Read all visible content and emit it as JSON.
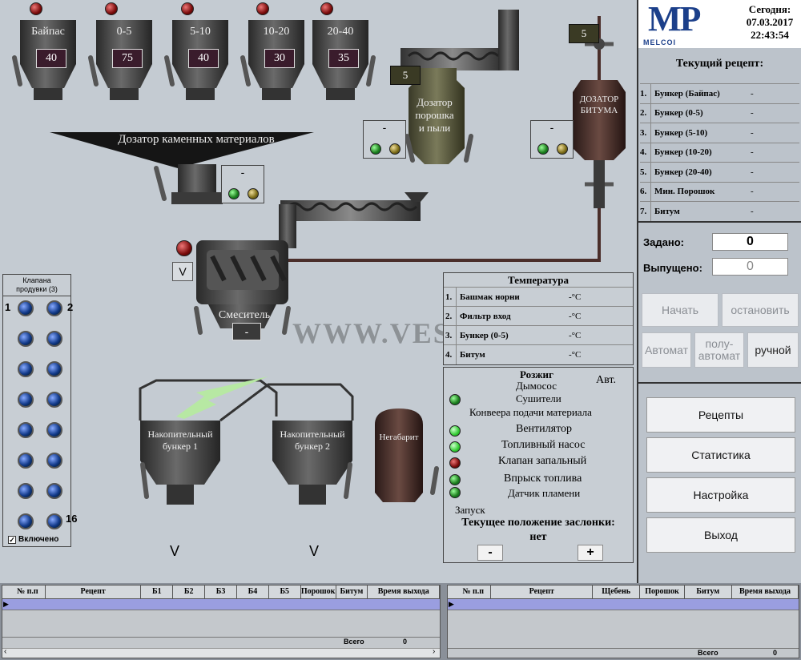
{
  "bunkers": [
    {
      "name": "Байпас",
      "value": "40"
    },
    {
      "name": "0-5",
      "value": "75"
    },
    {
      "name": "5-10",
      "value": "40"
    },
    {
      "name": "10-20",
      "value": "30"
    },
    {
      "name": "20-40",
      "value": "35"
    }
  ],
  "stone_dispenser": {
    "label": "Дозатор каменных материалов",
    "state": "-"
  },
  "powder_dispenser": {
    "label_l1": "Дозатор",
    "label_l2": "порошка",
    "label_l3": "и пыли",
    "value": "5",
    "state": "-"
  },
  "bitumen_dispenser": {
    "label_l1": "ДОЗАТОР",
    "label_l2": "БИТУМА",
    "value": "5",
    "state": "-"
  },
  "mixer": {
    "label": "Смеситель",
    "state": "-",
    "v_button": "V"
  },
  "valves_panel": {
    "title_l1": "Клапана",
    "title_l2": "продувки (3)",
    "first_num": "1",
    "second_num": "2",
    "last_num": "16",
    "enabled_label": "Включено"
  },
  "storage": {
    "bunker1_l1": "Накопительный",
    "bunker1_l2": "бункер 1",
    "bunker2_l1": "Накопительный",
    "bunker2_l2": "бункер 2",
    "oversize": "Негабарит",
    "v1": "V",
    "v2": "V"
  },
  "watermark": "WWW.VESY.KZ",
  "temperature": {
    "title": "Температура",
    "rows": [
      {
        "n": "1.",
        "name": "Башмак норни",
        "val": "-°C"
      },
      {
        "n": "2.",
        "name": "Фильтр вход",
        "val": "-°C"
      },
      {
        "n": "3.",
        "name": "Бункер (0-5)",
        "val": "-°C"
      },
      {
        "n": "4.",
        "name": "Битум",
        "val": "-°C"
      }
    ]
  },
  "ignition": {
    "title": "Розжиг",
    "mode": "Авт.",
    "smoke": "Дымосос",
    "dryers": "Сушители",
    "conveyor": "Конвеера подачи материала",
    "fan": "Вентилятор",
    "fuel_pump": "Топливный насос",
    "ign_valve": "Клапан запальный",
    "fuel_inject": "Впрыск топлива",
    "flame_sensor": "Датчик пламени",
    "launch": "Запуск",
    "damper_label": "Текущее положение заслонки:",
    "damper_value": "нет",
    "minus": "-",
    "plus": "+"
  },
  "header": {
    "logo_main": "MP",
    "logo_sub": "MELCOI",
    "today_label": "Сегодня:",
    "date": "07.03.2017",
    "time": "22:43:54"
  },
  "recipe": {
    "title": "Текущий рецепт:",
    "items": [
      {
        "n": "1.",
        "name": "Бункер (Байпас)",
        "val": "-"
      },
      {
        "n": "2.",
        "name": "Бункер (0-5)",
        "val": "-"
      },
      {
        "n": "3.",
        "name": "Бункер (5-10)",
        "val": "-"
      },
      {
        "n": "4.",
        "name": "Бункер (10-20)",
        "val": "-"
      },
      {
        "n": "5.",
        "name": "Бункер (20-40)",
        "val": "-"
      },
      {
        "n": "6.",
        "name": "Мин. Порошок",
        "val": "-"
      },
      {
        "n": "7.",
        "name": "Битум",
        "val": "-"
      }
    ]
  },
  "batch": {
    "set_label": "Задано:",
    "set_value": "0",
    "released_label": "Выпущено:",
    "released_value": "0"
  },
  "controls": {
    "start": "Начать",
    "stop": "остановить",
    "auto": "Автомат",
    "semi_l1": "полу-",
    "semi_l2": "автомат",
    "manual": "ручной"
  },
  "menu": {
    "recipes": "Рецепты",
    "stats": "Статистика",
    "settings": "Настройка",
    "exit": "Выход"
  },
  "table_left": {
    "headers": [
      "№ п.п",
      "Рецепт",
      "Б1",
      "Б2",
      "Б3",
      "Б4",
      "Б5",
      "Порошок",
      "Битум",
      "Время выхода"
    ],
    "total_label": "Всего",
    "total_value": "0"
  },
  "table_right": {
    "headers": [
      "№ п.п",
      "Рецепт",
      "Щебень",
      "Порошок",
      "Битум",
      "Время выхода"
    ],
    "total_label": "Всего",
    "total_value": "0"
  },
  "colors": {
    "background": "#c4cbd2",
    "dark_equipment": "#3a3a3a",
    "panel": "#c8ced4",
    "selected_row": "#9a9ee0"
  }
}
